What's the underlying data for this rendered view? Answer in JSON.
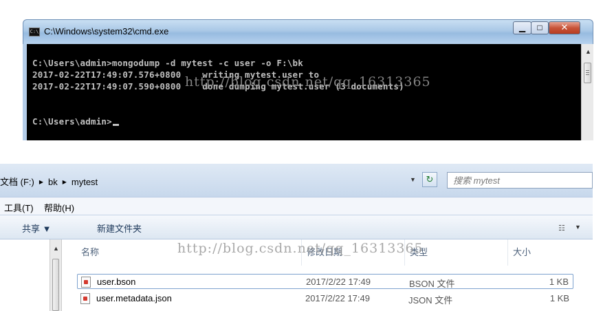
{
  "cmd": {
    "title": "C:\\Windows\\system32\\cmd.exe",
    "icon": "cmd-icon",
    "icon_text": "C:\\",
    "buttons": {
      "minimize": "▁",
      "maximize": "□",
      "close": "✕"
    },
    "lines": [
      "C:\\Users\\admin>mongodump -d mytest -c user -o F:\\bk",
      "2017-02-22T17:49:07.576+0800    writing mytest.user to",
      "2017-02-22T17:49:07.590+0800    done dumping mytest.user (3 documents)",
      "",
      "C:\\Users\\admin>"
    ],
    "scroll_up": "▲"
  },
  "watermark": "http://blog.csdn.net/qq_16313365",
  "explorer": {
    "breadcrumb": [
      "文档 (F:)",
      "bk",
      "mytest"
    ],
    "breadcrumb_sep": "▶",
    "address_dropdown": "▼",
    "refresh_icon": "↻",
    "search_placeholder": "搜索 mytest",
    "menu": [
      "工具(T)",
      "帮助(H)"
    ],
    "toolbar": {
      "share": "共享 ▼",
      "new_folder": "新建文件夹",
      "view_icon": "☷",
      "view_drop": "▼"
    },
    "scroll_up": "▲",
    "columns": {
      "name": "名称",
      "date": "修改日期",
      "type": "类型",
      "size": "大小"
    },
    "files": [
      {
        "name": "user.bson",
        "date": "2017/2/22 17:49",
        "type": "BSON 文件",
        "size": "1 KB"
      },
      {
        "name": "user.metadata.json",
        "date": "2017/2/22 17:49",
        "type": "JSON 文件",
        "size": "1 KB"
      }
    ]
  },
  "colors": {
    "console_bg": "#000000",
    "console_text": "#c0c0c0",
    "close_red": "#c8553a",
    "selection_border": "#7da2ce"
  }
}
